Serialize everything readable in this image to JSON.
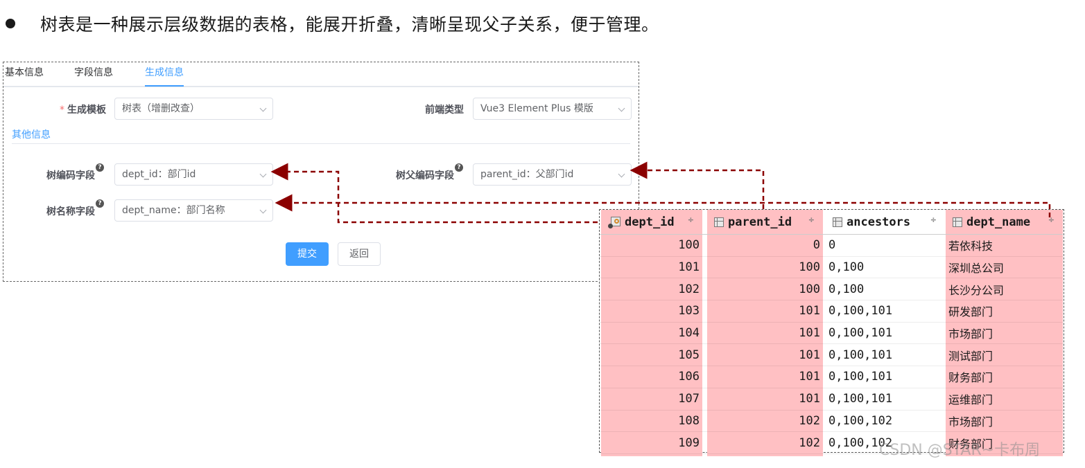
{
  "bullet": {
    "text": "树表是一种展示层级数据的表格，能展开折叠，清晰呈现父子关系，便于管理。"
  },
  "tabs": [
    {
      "label": "基本信息",
      "active": false
    },
    {
      "label": "字段信息",
      "active": false
    },
    {
      "label": "生成信息",
      "active": true
    }
  ],
  "form": {
    "required_mark": "*",
    "gen_template": {
      "label": "生成模板",
      "value": "树表（增删改查）"
    },
    "frontend_type": {
      "label": "前端类型",
      "value": "Vue3 Element Plus 模版"
    },
    "other_section_title": "其他信息",
    "tree_code": {
      "label": "树编码字段",
      "value": "dept_id：部门id"
    },
    "tree_parent_code": {
      "label": "树父编码字段",
      "value": "parent_id：父部门id"
    },
    "tree_name": {
      "label": "树名称字段",
      "value": "dept_name：部门名称"
    },
    "help_glyph": "?",
    "submit_label": "提交",
    "back_label": "返回"
  },
  "db_table": {
    "columns": [
      "dept_id",
      "parent_id",
      "ancestors",
      "dept_name"
    ],
    "sort_glyph": "÷",
    "rows": [
      [
        "100",
        "0",
        "0",
        "若依科技"
      ],
      [
        "101",
        "100",
        "0,100",
        "深圳总公司"
      ],
      [
        "102",
        "100",
        "0,100",
        "长沙分公司"
      ],
      [
        "103",
        "101",
        "0,100,101",
        "研发部门"
      ],
      [
        "104",
        "101",
        "0,100,101",
        "市场部门"
      ],
      [
        "105",
        "101",
        "0,100,101",
        "测试部门"
      ],
      [
        "106",
        "101",
        "0,100,101",
        "财务部门"
      ],
      [
        "107",
        "101",
        "0,100,101",
        "运维部门"
      ],
      [
        "108",
        "102",
        "0,100,102",
        "市场部门"
      ],
      [
        "109",
        "102",
        "0,100,102",
        "财务部门"
      ]
    ]
  },
  "colors": {
    "accent": "#409eff",
    "highlight": "#ffc0c3",
    "arrow": "#8b0000",
    "required": "#f56c6c"
  },
  "watermark": "CSDN @STAR~卡布周"
}
